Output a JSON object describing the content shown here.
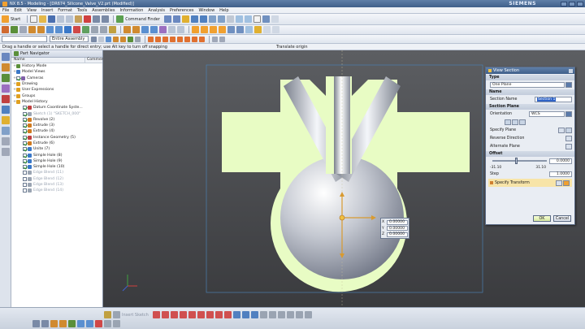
{
  "window": {
    "title": "NX 8.5 - Modeling - [DR674_Silicone_Valve_V2.prt (Modified)]",
    "brand": "SIEMENS"
  },
  "menu": [
    "File",
    "Edit",
    "View",
    "Insert",
    "Format",
    "Tools",
    "Assemblies",
    "Information",
    "Analysis",
    "Preferences",
    "Window",
    "Help"
  ],
  "toolbar": {
    "start_label": "Start",
    "command_finder_label": "Command Finder",
    "selection_filter": "",
    "assembly_scope": "Entire Assembly",
    "sketch_label": "Insert Sketch"
  },
  "cue_line": "Drag a handle or select a handle for direct entry; use Alt key to turn off snapping",
  "status_line": "Translate origin",
  "navigator": {
    "title": "Part Navigator",
    "col_name": "Name",
    "col_comment": "Comment",
    "items": [
      {
        "label": "History Mode",
        "indent": 0,
        "icon_color": "#5a8f3a",
        "checked": null,
        "dim": false
      },
      {
        "label": "Model Views",
        "indent": 0,
        "icon_color": "#3a78c8",
        "checked": null,
        "dim": false
      },
      {
        "label": "Cameras",
        "indent": 0,
        "icon_color": "#8060a8",
        "checked": true,
        "dim": false
      },
      {
        "label": "Drawing",
        "indent": 0,
        "icon_color": "#e0a020",
        "checked": null,
        "dim": false
      },
      {
        "label": "User Expressions",
        "indent": 0,
        "icon_color": "#e0a020",
        "checked": null,
        "dim": false
      },
      {
        "label": "Groups",
        "indent": 0,
        "icon_color": "#e0a020",
        "checked": null,
        "dim": false
      },
      {
        "label": "Model History",
        "indent": 0,
        "icon_color": "#e0a020",
        "checked": null,
        "dim": false
      },
      {
        "label": "Datum Coordinate Syste...",
        "indent": 1,
        "icon_color": "#c04040",
        "checked": true,
        "dim": false
      },
      {
        "label": "Sketch (1) \"SKETCH_000\"",
        "indent": 1,
        "icon_color": "#9aa4b2",
        "checked": true,
        "dim": true
      },
      {
        "label": "Revolve (2)",
        "indent": 1,
        "icon_color": "#d07a20",
        "checked": true,
        "dim": false
      },
      {
        "label": "Extrude (3)",
        "indent": 1,
        "icon_color": "#d07a20",
        "checked": true,
        "dim": false
      },
      {
        "label": "Extrude (4)",
        "indent": 1,
        "icon_color": "#d07a20",
        "checked": true,
        "dim": false
      },
      {
        "label": "Instance Geometry (5)",
        "indent": 1,
        "icon_color": "#c04040",
        "checked": true,
        "dim": false
      },
      {
        "label": "Extrude (6)",
        "indent": 1,
        "icon_color": "#d07a20",
        "checked": true,
        "dim": false
      },
      {
        "label": "Unite (7)",
        "indent": 1,
        "icon_color": "#3a78c8",
        "checked": true,
        "dim": false
      },
      {
        "label": "Simple Hole (8)",
        "indent": 1,
        "icon_color": "#3a78c8",
        "checked": true,
        "dim": false
      },
      {
        "label": "Simple Hole (9)",
        "indent": 1,
        "icon_color": "#3a78c8",
        "checked": true,
        "dim": false
      },
      {
        "label": "Simple Hole (10)",
        "indent": 1,
        "icon_color": "#3a78c8",
        "checked": true,
        "dim": false
      },
      {
        "label": "Edge Blend (11)",
        "indent": 1,
        "icon_color": "#9aa4b2",
        "checked": false,
        "dim": true
      },
      {
        "label": "Edge Blend (12)",
        "indent": 1,
        "icon_color": "#9aa4b2",
        "checked": false,
        "dim": true
      },
      {
        "label": "Edge Blend (13)",
        "indent": 1,
        "icon_color": "#9aa4b2",
        "checked": false,
        "dim": true
      },
      {
        "label": "Edge Blend (14)",
        "indent": 1,
        "icon_color": "#9aa4b2",
        "checked": false,
        "dim": true
      }
    ]
  },
  "coord_box": {
    "x_label": "X",
    "y_label": "Y",
    "z_label": "Z",
    "x": "0.00000",
    "y": "0.00000",
    "z": "0.00000"
  },
  "dialog": {
    "title": "View Section",
    "type_group": "Type",
    "type_value": "One Plane",
    "name_group": "Name",
    "section_name_label": "Section Name",
    "section_name_value": "Section 1",
    "plane_group": "Section Plane",
    "orientation_label": "Orientation",
    "orientation_value": "WCS",
    "specify_plane_label": "Specify Plane",
    "reverse_direction_label": "Reverse Direction",
    "alternate_plane_label": "Alternate Plane",
    "offset_group": "Offset",
    "offset_value": "0.0000",
    "range_min": "-31.10",
    "range_max": "31.10",
    "step_label": "Step",
    "step_value": "1.0000",
    "specify_transform_label": "Specify Transform",
    "ok_label": "OK",
    "cancel_label": "Cancel"
  },
  "colors": {
    "part_face": "#e8fcc4",
    "section_body": "#c8ccd4",
    "background_top": "#5c5e62",
    "accent": "#3f5f8a"
  }
}
